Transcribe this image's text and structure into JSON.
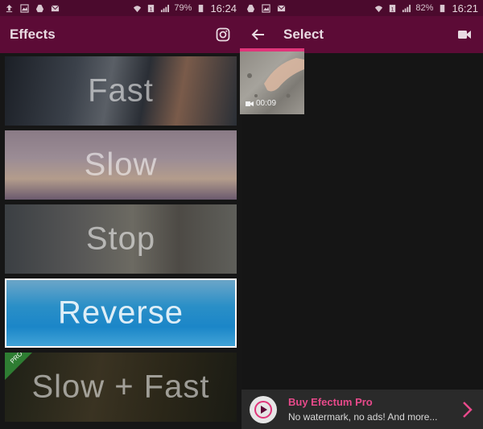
{
  "left": {
    "status": {
      "battery": "79%",
      "time": "16:24"
    },
    "appbar": {
      "title": "Effects"
    },
    "tiles": [
      {
        "label": "Fast"
      },
      {
        "label": "Slow"
      },
      {
        "label": "Stop"
      },
      {
        "label": "Reverse"
      },
      {
        "label": "Slow + Fast",
        "badge": "PRO"
      }
    ]
  },
  "right": {
    "status": {
      "battery": "82%",
      "time": "16:21"
    },
    "appbar": {
      "title": "Select"
    },
    "video": {
      "duration": "00:09"
    },
    "promo": {
      "title": "Buy Efectum Pro",
      "subtitle": "No watermark, no ads! And more..."
    }
  },
  "colors": {
    "statusbar": "#4b0a2d",
    "appbar": "#5c0b36",
    "accent": "#e0357a",
    "promo_title": "#e84a8b"
  },
  "icons": [
    "upload-icon",
    "image-icon",
    "drive-icon",
    "mail-icon",
    "wifi-icon",
    "sim-icon",
    "signal-icon",
    "battery-icon",
    "instagram-icon",
    "back-arrow-icon",
    "video-camera-icon",
    "chevron-right-icon"
  ]
}
